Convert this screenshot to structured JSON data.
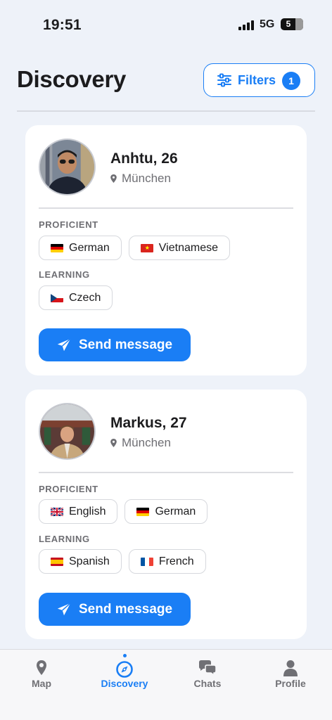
{
  "status_bar": {
    "time": "19:51",
    "network": "5G",
    "battery": "53",
    "battery_display": "5"
  },
  "header": {
    "title": "Discovery",
    "filters_label": "Filters",
    "filters_count": "1"
  },
  "profiles": [
    {
      "name": "Anhtu, 26",
      "location": "München",
      "proficient_label": "PROFICIENT",
      "learning_label": "LEARNING",
      "proficient": [
        {
          "flag": "de",
          "name": "German"
        },
        {
          "flag": "vn",
          "name": "Vietnamese"
        }
      ],
      "learning": [
        {
          "flag": "cz",
          "name": "Czech"
        }
      ],
      "button_label": "Send message"
    },
    {
      "name": "Markus, 27",
      "location": "München",
      "proficient_label": "PROFICIENT",
      "learning_label": "LEARNING",
      "proficient": [
        {
          "flag": "gb",
          "name": "English"
        },
        {
          "flag": "de",
          "name": "German"
        }
      ],
      "learning": [
        {
          "flag": "es",
          "name": "Spanish"
        },
        {
          "flag": "fr",
          "name": "French"
        }
      ],
      "button_label": "Send message"
    }
  ],
  "tabs": [
    {
      "label": "Map",
      "icon": "map-pin-icon",
      "active": false
    },
    {
      "label": "Discovery",
      "icon": "compass-icon",
      "active": true
    },
    {
      "label": "Chats",
      "icon": "chat-bubbles-icon",
      "active": false
    },
    {
      "label": "Profile",
      "icon": "person-icon",
      "active": false
    }
  ],
  "colors": {
    "accent": "#1a7ef5",
    "background": "#eef2f9",
    "card": "#ffffff",
    "muted_text": "#6e6e73"
  }
}
